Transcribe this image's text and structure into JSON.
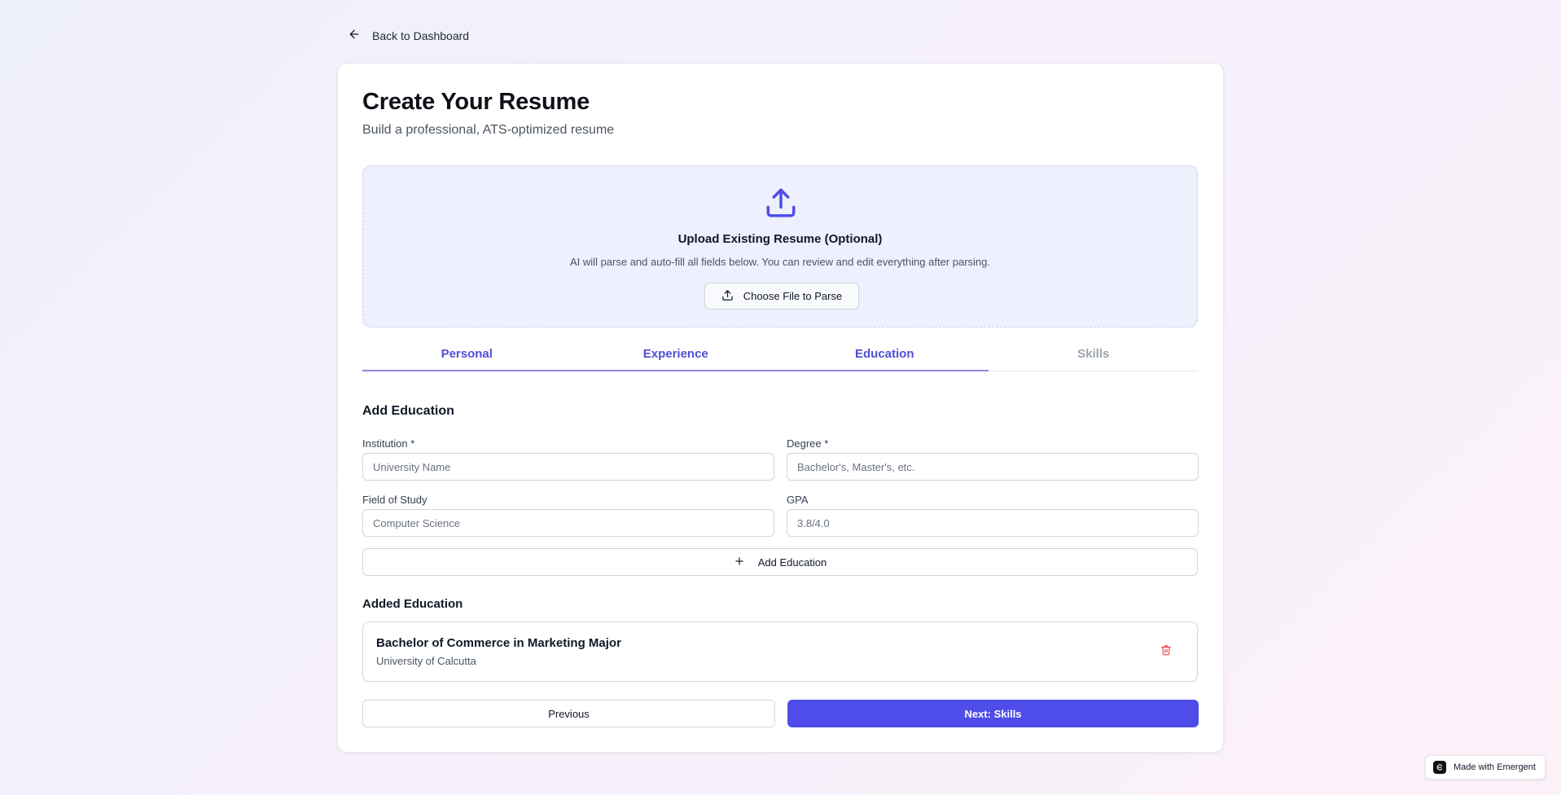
{
  "nav": {
    "back_label": "Back to Dashboard",
    "back_icon": "arrow-left-icon"
  },
  "header": {
    "title": "Create Your Resume",
    "subtitle": "Build a professional, ATS-optimized resume"
  },
  "upload": {
    "icon": "upload-icon",
    "title": "Upload Existing Resume (Optional)",
    "description": "AI will parse and auto-fill all fields below. You can review and edit everything after parsing.",
    "button_label": "Choose File to Parse"
  },
  "tabs": [
    {
      "label": "Personal",
      "state": "completed"
    },
    {
      "label": "Experience",
      "state": "completed"
    },
    {
      "label": "Education",
      "state": "active"
    },
    {
      "label": "Skills",
      "state": "upcoming"
    }
  ],
  "form": {
    "section_title": "Add Education",
    "institution": {
      "label": "Institution *",
      "placeholder": "University Name",
      "value": ""
    },
    "degree": {
      "label": "Degree *",
      "placeholder": "Bachelor's, Master's, etc.",
      "value": ""
    },
    "field_of_study": {
      "label": "Field of Study",
      "placeholder": "Computer Science",
      "value": ""
    },
    "gpa": {
      "label": "GPA",
      "placeholder": "3.8/4.0",
      "value": ""
    },
    "add_button_label": "Add Education"
  },
  "added": {
    "title": "Added Education",
    "items": [
      {
        "degree": "Bachelor of Commerce in Marketing Major",
        "institution": "University of Calcutta"
      }
    ]
  },
  "footer": {
    "previous_label": "Previous",
    "next_label": "Next: Skills"
  },
  "badge": {
    "label": "Made with Emergent"
  },
  "colors": {
    "accent": "#4e4de9",
    "tab_active": "#4f4fd6",
    "tab_inactive": "#9ca3af",
    "upload_bg": "#eef0fd",
    "delete": "#ef4444"
  }
}
